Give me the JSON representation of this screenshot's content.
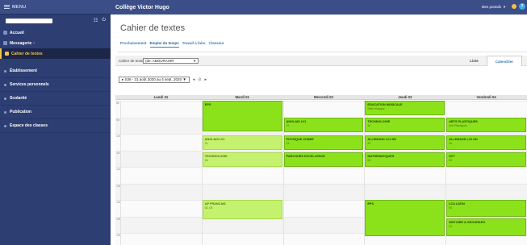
{
  "sidebar": {
    "menu_label": "MENU",
    "user_name": "",
    "items": [
      {
        "label": "Accueil",
        "active": false,
        "badge": ""
      },
      {
        "label": "Messagerie",
        "active": false,
        "badge": "•"
      },
      {
        "label": "Cahier de textes",
        "active": true,
        "badge": ""
      }
    ],
    "sections": [
      {
        "label": "Établissement"
      },
      {
        "label": "Services personnels"
      },
      {
        "label": "Scolarité"
      },
      {
        "label": "Publication"
      },
      {
        "label": "Espace des classes"
      }
    ]
  },
  "topbar": {
    "school": "Collège Victor Hugo",
    "portals": "Mes portails",
    "help": "?"
  },
  "main": {
    "title": "Cahier de textes",
    "tabs": [
      {
        "label": "Prochainement",
        "active": false
      },
      {
        "label": "Emploi du temps",
        "active": true
      },
      {
        "label": "Travail à faire",
        "active": false
      },
      {
        "label": "Classeur",
        "active": false
      }
    ],
    "toolbar": {
      "label": "Cahier de textes",
      "select_value": "(de: ABOURAHIR",
      "view_tabs": [
        {
          "label": "Liste",
          "active": false
        },
        {
          "label": "Calendrier",
          "active": true
        }
      ]
    },
    "week_range": "▸ S36 - 31 août 2020 au 4 sept. 2020 ▼",
    "nav_prev": "◂",
    "nav_today": "⊙",
    "nav_next": "▸"
  },
  "calendar": {
    "days": [
      "Lundi 31",
      "Mardi 01",
      "Mercredi 02",
      "Jeudi 03",
      "Vendredi 04"
    ],
    "hours": [
      "8h",
      "9h",
      "10h",
      "11h",
      "12h",
      "13h",
      "14h",
      "15h",
      "16h"
    ],
    "events": [
      {
        "day": 1,
        "start": 0,
        "end": 1.85,
        "title": "EPS",
        "room": "",
        "style": "dark"
      },
      {
        "day": 3,
        "start": 0,
        "end": 0.9,
        "title": "EDUCATION MUSICALE",
        "room": "Salle Musique",
        "style": "dark"
      },
      {
        "day": 2,
        "start": 1.0,
        "end": 1.9,
        "title": "ANGLAIS LV1",
        "room": "21",
        "style": "dark"
      },
      {
        "day": 3,
        "start": 1.0,
        "end": 1.9,
        "title": "TECHNOLOGIE",
        "room": "16",
        "style": "dark"
      },
      {
        "day": 4,
        "start": 1.0,
        "end": 1.9,
        "title": "ARTS PLASTIQUES",
        "room": "Arts Plastiques",
        "style": "dark"
      },
      {
        "day": 1,
        "start": 2.1,
        "end": 3.0,
        "title": "ANGLAIS LV1",
        "room": "21",
        "style": "light"
      },
      {
        "day": 2,
        "start": 2.1,
        "end": 3.0,
        "title": "PHYSIQUE-CHIMIE",
        "room": "14",
        "style": "dark"
      },
      {
        "day": 3,
        "start": 2.1,
        "end": 3.0,
        "title": "ALLEMAND LV2 ND",
        "room": "24",
        "style": "dark"
      },
      {
        "day": 4,
        "start": 2.1,
        "end": 3.0,
        "title": "ALLEMAND LV2 ND",
        "room": "06",
        "style": "dark"
      },
      {
        "day": 1,
        "start": 3.1,
        "end": 4.0,
        "title": "TECHNOLOGIE",
        "room": "16",
        "style": "light"
      },
      {
        "day": 2,
        "start": 3.1,
        "end": 4.0,
        "title": "PARCOURS EXCELLENCE",
        "room": "",
        "style": "dark"
      },
      {
        "day": 3,
        "start": 3.1,
        "end": 4.0,
        "title": "MATHEMATIQUES",
        "room": "05",
        "style": "dark"
      },
      {
        "day": 4,
        "start": 3.1,
        "end": 4.0,
        "title": "SVT",
        "room": "08",
        "style": "dark"
      },
      {
        "day": 1,
        "start": 6.0,
        "end": 7.15,
        "title": "AP FRANCAIS",
        "room": "02, 03",
        "style": "light"
      },
      {
        "day": 3,
        "start": 6.0,
        "end": 8.2,
        "title": "EPS",
        "room": "",
        "style": "dark"
      },
      {
        "day": 4,
        "start": 6.0,
        "end": 7.0,
        "title": "LCA LATIN",
        "room": "05",
        "style": "dark"
      },
      {
        "day": 4,
        "start": 7.1,
        "end": 8.2,
        "title": "HISTOIRE & GEOGRAPH",
        "room": "04",
        "style": "dark"
      }
    ]
  }
}
